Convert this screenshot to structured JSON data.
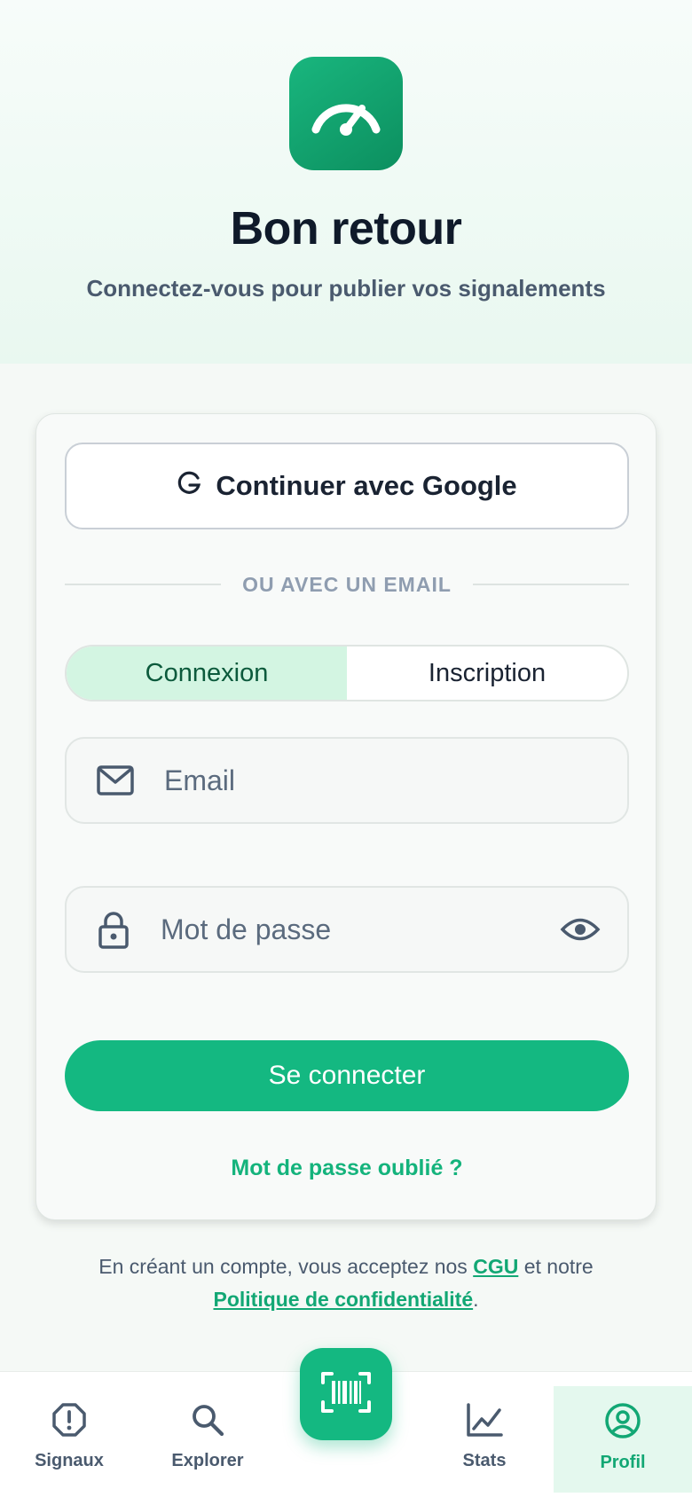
{
  "header": {
    "logo_icon": "speedometer-icon",
    "title": "Bon retour",
    "subtitle": "Connectez-vous pour publier vos signalements"
  },
  "auth": {
    "google_label": "Continuer avec Google",
    "divider_label": "OU AVEC UN EMAIL",
    "tabs": [
      {
        "label": "Connexion",
        "active": true
      },
      {
        "label": "Inscription",
        "active": false
      }
    ],
    "email_placeholder": "Email",
    "password_placeholder": "Mot de passe",
    "submit_label": "Se connecter",
    "forgot_label": "Mot de passe oublié ?"
  },
  "legal": {
    "prefix": "En créant un compte, vous acceptez nos",
    "cgu": "CGU",
    "middle": "et notre",
    "privacy": "Politique de confidentialité",
    "suffix": "."
  },
  "nav": {
    "items": [
      {
        "label": "Signaux",
        "icon": "alert-octagon-icon"
      },
      {
        "label": "Explorer",
        "icon": "search-icon"
      },
      {
        "label": "Stats",
        "icon": "line-chart-icon"
      },
      {
        "label": "Profil",
        "icon": "user-circle-icon",
        "active": true
      }
    ],
    "scan_icon": "barcode-scan-icon"
  },
  "colors": {
    "accent": "#14b881",
    "title": "#0f1a2a",
    "muted": "#4a5a6e"
  }
}
